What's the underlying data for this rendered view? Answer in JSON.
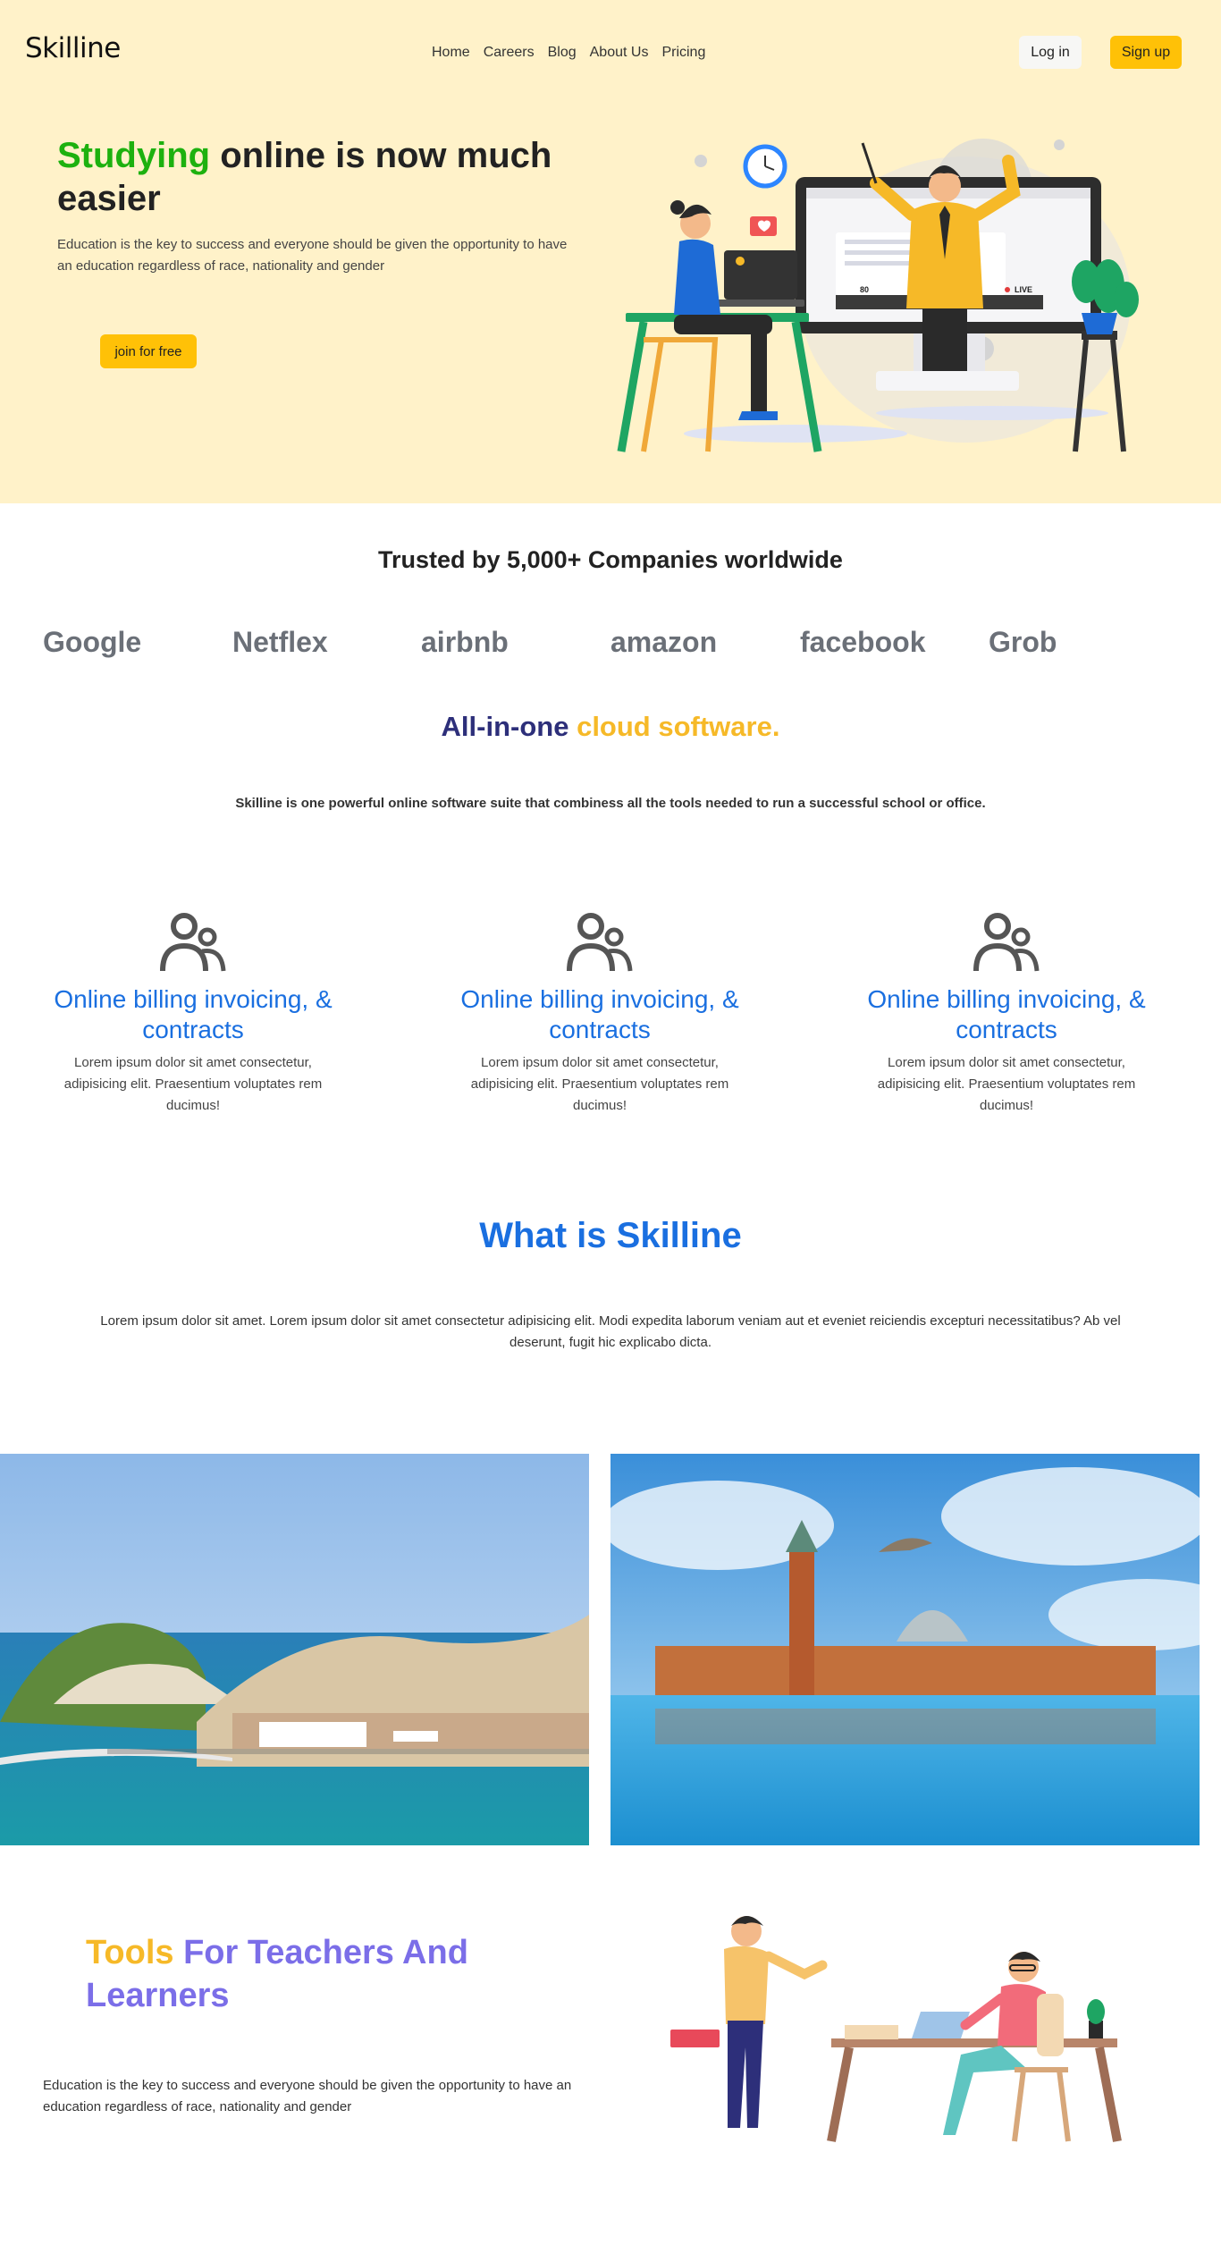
{
  "header": {
    "brand": "Skilline",
    "nav": [
      "Home",
      "Careers",
      "Blog",
      "About Us",
      "Pricing"
    ],
    "login_label": "Log in",
    "signup_label": "Sign up"
  },
  "hero": {
    "title_accent": "Studying",
    "title_rest": " online is now much easier",
    "subtitle": "Education is the key to success and everyone should be given the opportunity to have an education regardless of race, nationality and gender",
    "cta_label": "join for free",
    "video_count": "80",
    "live_label": "LIVE"
  },
  "trust": {
    "title": "Trusted by 5,000+ Companies worldwide",
    "logos": [
      "Google",
      "Netflex",
      "airbnb",
      "amazon",
      "facebook",
      "Grob"
    ]
  },
  "cloud": {
    "title_main": "All-in-one ",
    "title_accent": "cloud software.",
    "subtitle": "Skilline is one powerful online software suite that combiness all the tools needed to run a successful school or office."
  },
  "features": [
    {
      "title": "Online billing invoicing, & contracts",
      "text": "Lorem ipsum dolor sit amet consectetur, adipisicing elit. Praesentium voluptates rem ducimus!",
      "icon": "users-icon"
    },
    {
      "title": "Online billing invoicing, & contracts",
      "text": "Lorem ipsum dolor sit amet consectetur, adipisicing elit. Praesentium voluptates rem ducimus!",
      "icon": "users-icon"
    },
    {
      "title": "Online billing invoicing, & contracts",
      "text": "Lorem ipsum dolor sit amet consectetur, adipisicing elit. Praesentium voluptates rem ducimus!",
      "icon": "users-icon"
    }
  ],
  "what": {
    "title": "What is Skilline",
    "text": "Lorem ipsum dolor sit amet. Lorem ipsum dolor sit amet consectetur adipisicing elit. Modi expedita laborum veniam aut et eveniet reiciendis excepturi necessitatibus? Ab vel deserunt, fugit hic explicabo dicta."
  },
  "tools": {
    "title_accent": "Tools",
    "title_rest": " For Teachers And Learners",
    "text": "Education is the key to success and everyone should be given the opportunity to have an education regardless of race, nationality and gender"
  },
  "colors": {
    "hero_bg": "#fff2c9",
    "accent_yellow": "#ffc107",
    "accent_green": "#1db10f",
    "accent_blue": "#1a6fe0",
    "accent_navy": "#2d2f7a",
    "accent_purple": "#7b6ee8",
    "accent_gold": "#f6b928"
  }
}
